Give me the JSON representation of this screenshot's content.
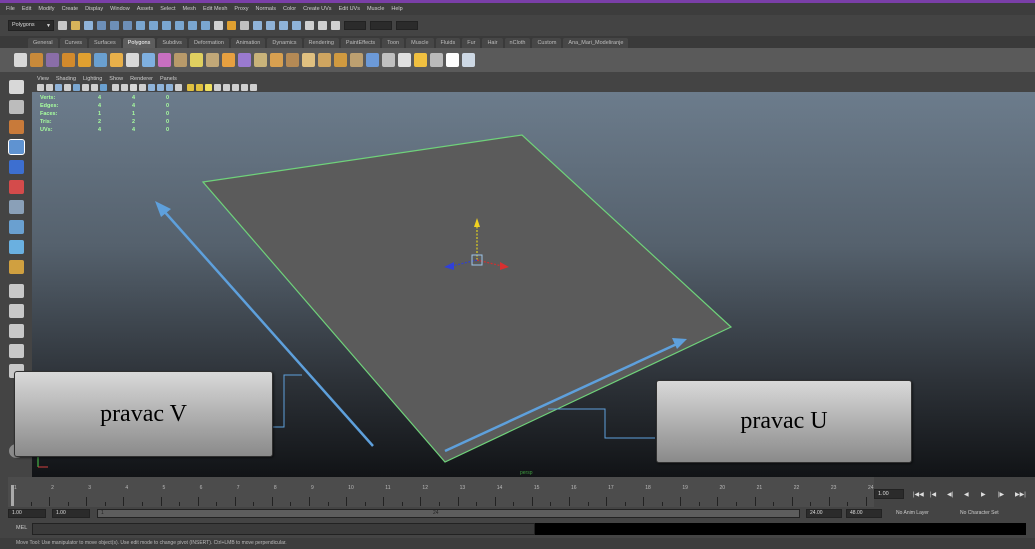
{
  "menubar": {
    "items": [
      "File",
      "Edit",
      "Modify",
      "Create",
      "Display",
      "Window",
      "Assets",
      "Select",
      "Mesh",
      "Edit Mesh",
      "Proxy",
      "Normals",
      "Color",
      "Create UVs",
      "Edit UVs",
      "Muscle",
      "Help"
    ]
  },
  "status_line": {
    "mode": "Polygons"
  },
  "shelf": {
    "tabs": [
      "General",
      "Curves",
      "Surfaces",
      "Polygons",
      "Subdivs",
      "Deformation",
      "Animation",
      "Dynamics",
      "Rendering",
      "PaintEffects",
      "Toon",
      "Muscle",
      "Fluids",
      "Fur",
      "Hair",
      "nCloth",
      "Custom",
      "Ana_Mari_Modeliranje"
    ],
    "active_tab": "Polygons",
    "icon_colors": [
      "#d8d8d8",
      "#c98a3a",
      "#8a6ea8",
      "#d28a2c",
      "#e0a030",
      "#6aa0d0",
      "#e8b04a",
      "#d9d9d9",
      "#7fb0e0",
      "#c86fc0",
      "#b89a6a",
      "#e0d060",
      "#c2a878",
      "#e6a040",
      "#9a7ad0",
      "#c9b37a",
      "#d8a050",
      "#b58a55",
      "#e0c080",
      "#cfa560",
      "#d09a40",
      "#bda070",
      "#6c9ad8",
      "#c0c0c0",
      "#e0e0e0",
      "#f0c040",
      "#bbbbbb",
      "#ffffff",
      "#cdd8e4"
    ]
  },
  "panel": {
    "menu": [
      "View",
      "Shading",
      "Lighting",
      "Show",
      "Renderer",
      "Panels"
    ],
    "hud": [
      {
        "label": "Verts:",
        "values": [
          "4",
          "4",
          "0"
        ]
      },
      {
        "label": "Edges:",
        "values": [
          "4",
          "4",
          "0"
        ]
      },
      {
        "label": "Faces:",
        "values": [
          "1",
          "1",
          "0"
        ]
      },
      {
        "label": "Tris:",
        "values": [
          "2",
          "2",
          "0"
        ]
      },
      {
        "label": "UVs:",
        "values": [
          "4",
          "4",
          "0"
        ]
      }
    ],
    "camera_name": "persp"
  },
  "annotations": {
    "v_label": "pravac V",
    "u_label": "pravac U"
  },
  "timeline": {
    "ticks": [
      "1",
      "2",
      "3",
      "4",
      "5",
      "6",
      "7",
      "8",
      "9",
      "10",
      "11",
      "12",
      "13",
      "14",
      "15",
      "16",
      "17",
      "18",
      "19",
      "20",
      "21",
      "22",
      "23",
      "24"
    ],
    "current_frame": "1.00",
    "playback_icons": [
      "go-to-start-icon",
      "step-back-key-icon",
      "step-back-icon",
      "play-back-icon",
      "play-forward-icon",
      "step-forward-icon",
      "go-to-end-icon"
    ]
  },
  "range": {
    "start": "1.00",
    "playback_start": "1.00",
    "slider_start": "1",
    "slider_end": "24",
    "playback_end": "24.00",
    "end": "48.00",
    "anim_layer": "No Anim Layer",
    "character_set": "No Character Set"
  },
  "command_line": {
    "label": "MEL"
  },
  "help_line": {
    "text": "Move Tool: Use manipulator to move object(s). Use edit mode to change pivot (INSERT). Ctrl+LMB to move perpendicular."
  },
  "colors": {
    "accent": "#6fa0d8",
    "arrow": "#5ea0dc",
    "plane": "#5b5b5b",
    "plane_edge": "#6fd27a",
    "hud_text": "#a8ff9f"
  }
}
